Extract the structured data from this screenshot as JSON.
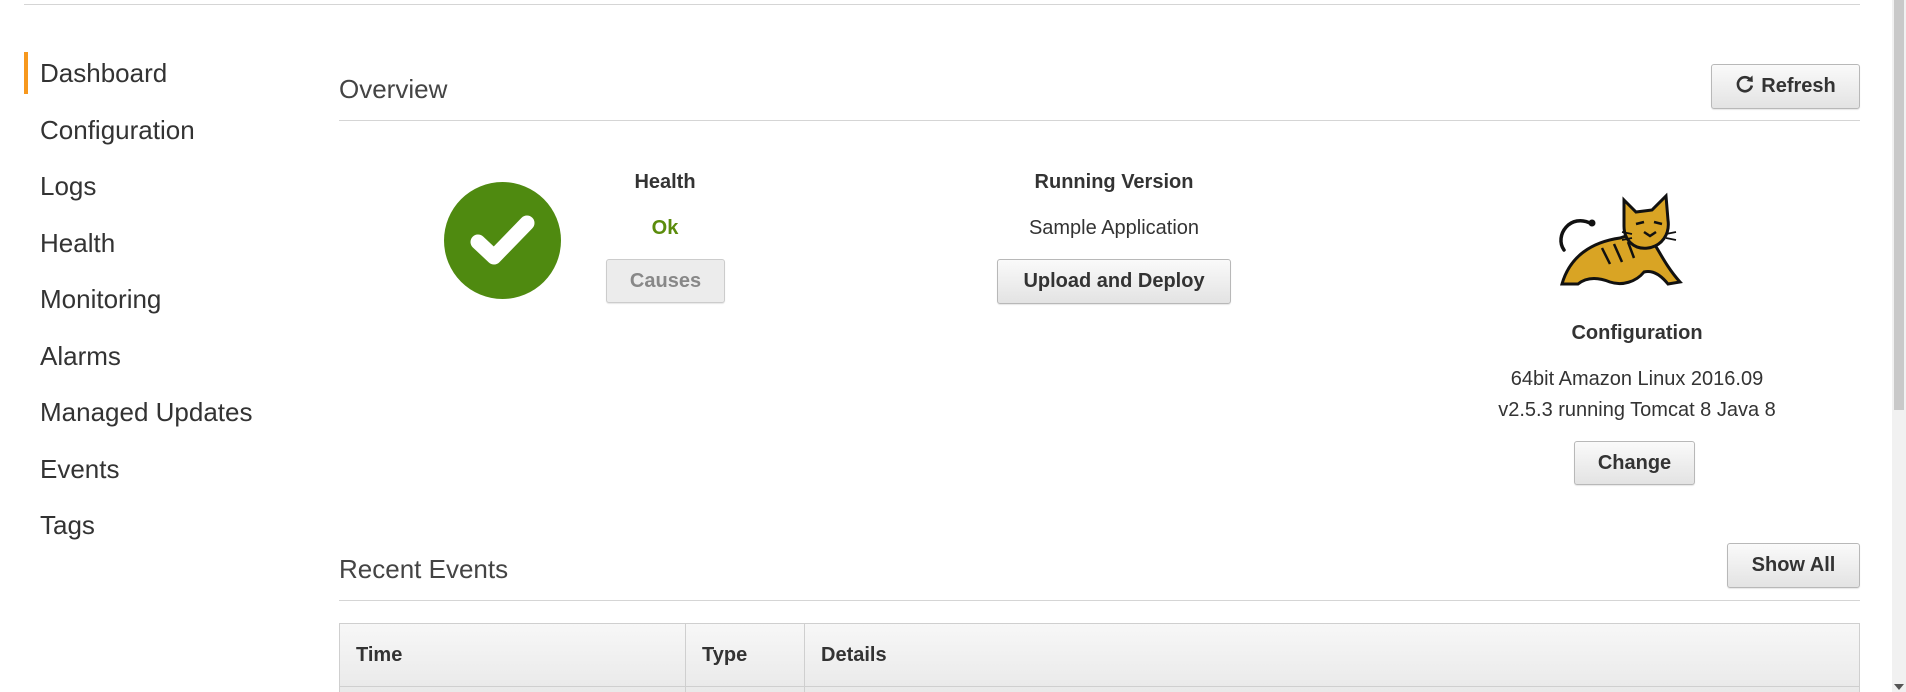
{
  "sidebar": {
    "items": [
      {
        "label": "Dashboard",
        "active": true
      },
      {
        "label": "Configuration"
      },
      {
        "label": "Logs"
      },
      {
        "label": "Health"
      },
      {
        "label": "Monitoring"
      },
      {
        "label": "Alarms"
      },
      {
        "label": "Managed Updates"
      },
      {
        "label": "Events"
      },
      {
        "label": "Tags"
      }
    ],
    "active_color": "#f7981d"
  },
  "overview": {
    "title": "Overview",
    "refresh_label": "Refresh",
    "health": {
      "label": "Health",
      "status": "Ok",
      "status_color": "#5b8c0c",
      "causes_label": "Causes",
      "icon": "checkmark-circle-icon",
      "icon_color": "#4f8a10"
    },
    "running_version": {
      "label": "Running Version",
      "value": "Sample Application",
      "upload_label": "Upload and Deploy"
    },
    "configuration": {
      "label": "Configuration",
      "line1": "64bit Amazon Linux 2016.09",
      "line2": "v2.5.3 running Tomcat 8 Java 8",
      "change_label": "Change",
      "icon": "tomcat-logo-icon"
    }
  },
  "recent_events": {
    "title": "Recent Events",
    "show_all_label": "Show All",
    "columns": [
      "Time",
      "Type",
      "Details"
    ]
  }
}
